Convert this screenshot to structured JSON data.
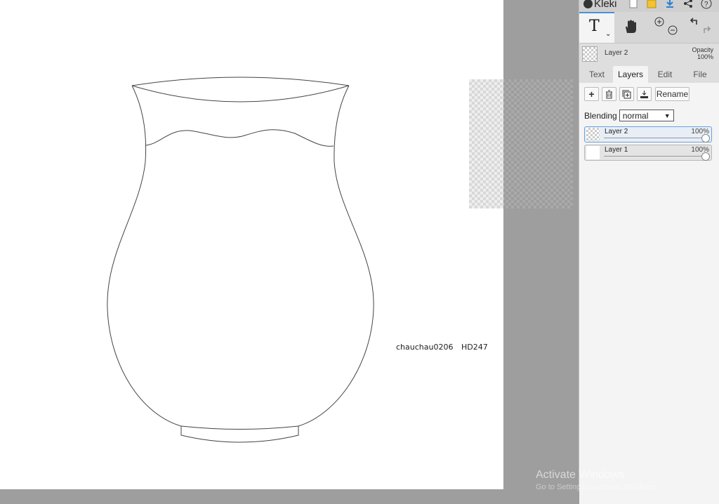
{
  "app": {
    "name": "Kleki"
  },
  "canvas": {
    "watermark": "chauchau0206",
    "code": "HD247"
  },
  "toolbar": {
    "text_tool": "T",
    "icons": [
      "new-file-icon",
      "folder-icon",
      "download-icon",
      "share-icon",
      "help-icon"
    ]
  },
  "current_layer": {
    "name": "Layer 2",
    "opacity_label": "Opacity",
    "opacity_value": "100%"
  },
  "tabs": [
    {
      "label": "Text",
      "active": false
    },
    {
      "label": "Layers",
      "active": true
    },
    {
      "label": "Edit",
      "active": false
    },
    {
      "label": "File",
      "active": false
    }
  ],
  "layers_panel": {
    "rename_label": "Rename",
    "blending_label": "Blending",
    "blending_value": "normal",
    "layers": [
      {
        "name": "Layer 2",
        "opacity": "100%",
        "selected": true
      },
      {
        "name": "Layer 1",
        "opacity": "100%",
        "selected": false
      }
    ]
  },
  "os_overlay": {
    "title": "Activate Windows",
    "subtitle": "Go to Settings to activate Windows."
  }
}
